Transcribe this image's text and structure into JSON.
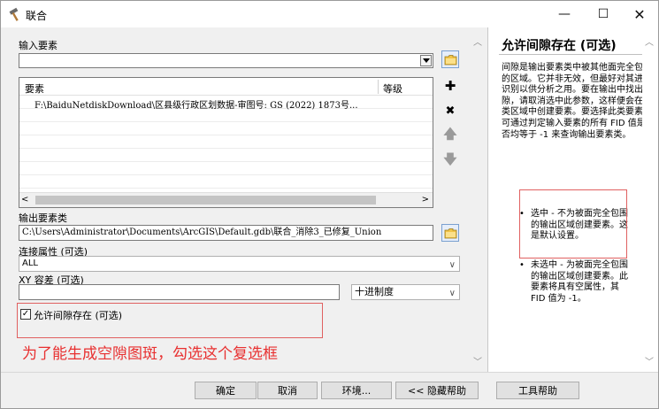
{
  "window": {
    "title": "联合"
  },
  "input_features": {
    "label": "输入要素",
    "value": "",
    "table": {
      "col_feature": "要素",
      "col_rank": "等级",
      "rows": [
        {
          "feature": "F:\\BaiduNetdiskDownload\\区县级行政区划数据-审图号: GS (2022) 1873号...",
          "rank": ""
        }
      ]
    }
  },
  "output": {
    "label": "输出要素类",
    "value": "C:\\Users\\Administrator\\Documents\\ArcGIS\\Default.gdb\\联合_消除3_已修复_Union"
  },
  "join_attributes": {
    "label": "连接属性 (可选)",
    "value": "ALL"
  },
  "xy_tolerance": {
    "label": "XY 容差 (可选)",
    "value": "",
    "unit": "十进制度"
  },
  "gaps": {
    "label": "允许间隙存在 (可选)",
    "checked": true,
    "check_mark": "✓"
  },
  "annotation": {
    "text": "为了能生成空隙图斑，勾选这个复选框",
    "color": "#e83030"
  },
  "help": {
    "title": "允许间隙存在 (可选)",
    "body": "间隙是输出要素类中被其他面完全包围的区域。它并非无效，但最好对其进行识别以供分析之用。要在输出中找出间隙，请取消选中此参数，这样便会在此类区域中创建要素。要选择此类要素，可通过判定输入要素的所有 FID 值是否均等于 -1 来查询输出要素类。",
    "bullets": [
      {
        "dot": "•",
        "text": "选中 - 不为被面完全包围的输出区域创建要素。这是默认设置。"
      },
      {
        "dot": "•",
        "text": "未选中 - 为被面完全包围的输出区域创建要素。此要素将具有空属性，其 FID 值为 -1。"
      }
    ]
  },
  "buttons": {
    "ok": "确定",
    "cancel": "取消",
    "environments": "环境...",
    "hide_help": "<< 隐藏帮助",
    "tool_help": "工具帮助"
  },
  "icons": {
    "window_minimize": "—",
    "window_maximize": "☐",
    "window_close": "✕",
    "add": "✚",
    "remove": "✖",
    "up": "🡅",
    "down": "🡇",
    "scroll_left": "<",
    "scroll_right": ">",
    "scroll_up": "︿",
    "scroll_down": "﹀",
    "chevron": "∨"
  },
  "colors": {
    "highlight": "#e06060"
  }
}
